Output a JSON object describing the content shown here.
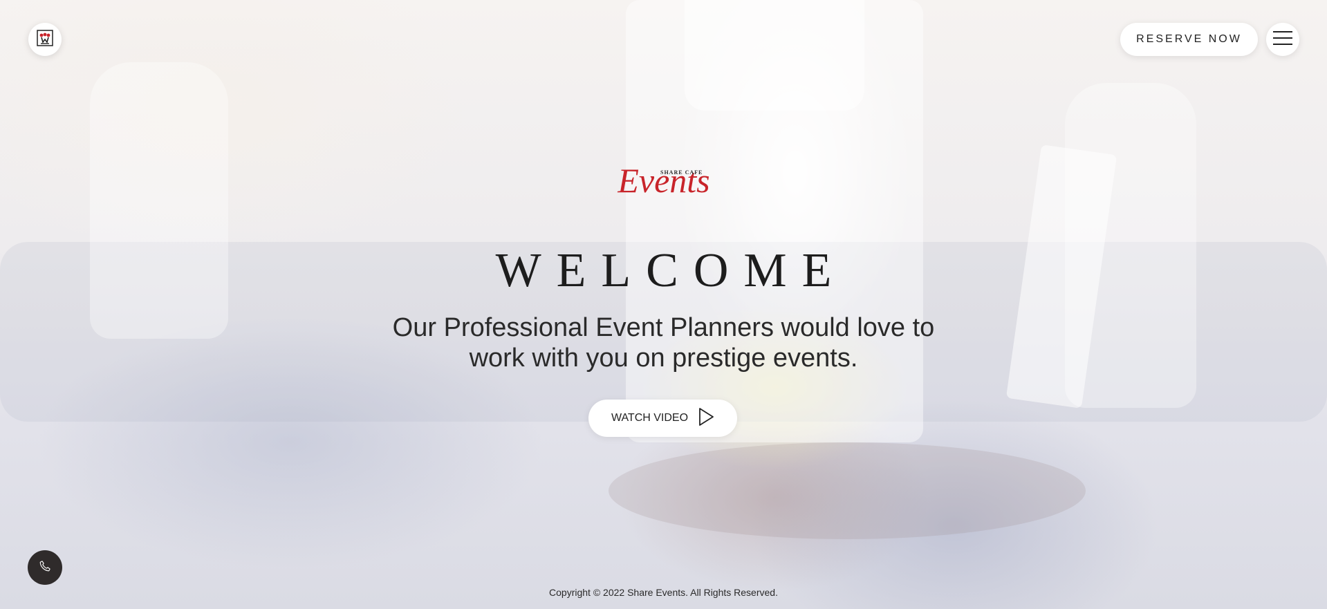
{
  "header": {
    "logo_icon": "share-cafe-logo-icon",
    "reserve_label": "RESERVE NOW",
    "menu_icon": "hamburger-menu-icon"
  },
  "brand": {
    "top_text": "SHARE CAFE",
    "script_text": "Events",
    "color": "#c8242a"
  },
  "hero": {
    "title": "WELCOME",
    "tagline_line1": "Our Professional Event Planners would love to",
    "tagline_line2": "work with you on prestige events.",
    "watch_label": "WATCH VIDEO",
    "play_icon": "play-icon"
  },
  "floating": {
    "phone_icon": "phone-icon",
    "phone_bg": "#2f2b2b"
  },
  "footer": {
    "copyright": "Copyright © 2022 Share Events. All Rights Reserved."
  }
}
